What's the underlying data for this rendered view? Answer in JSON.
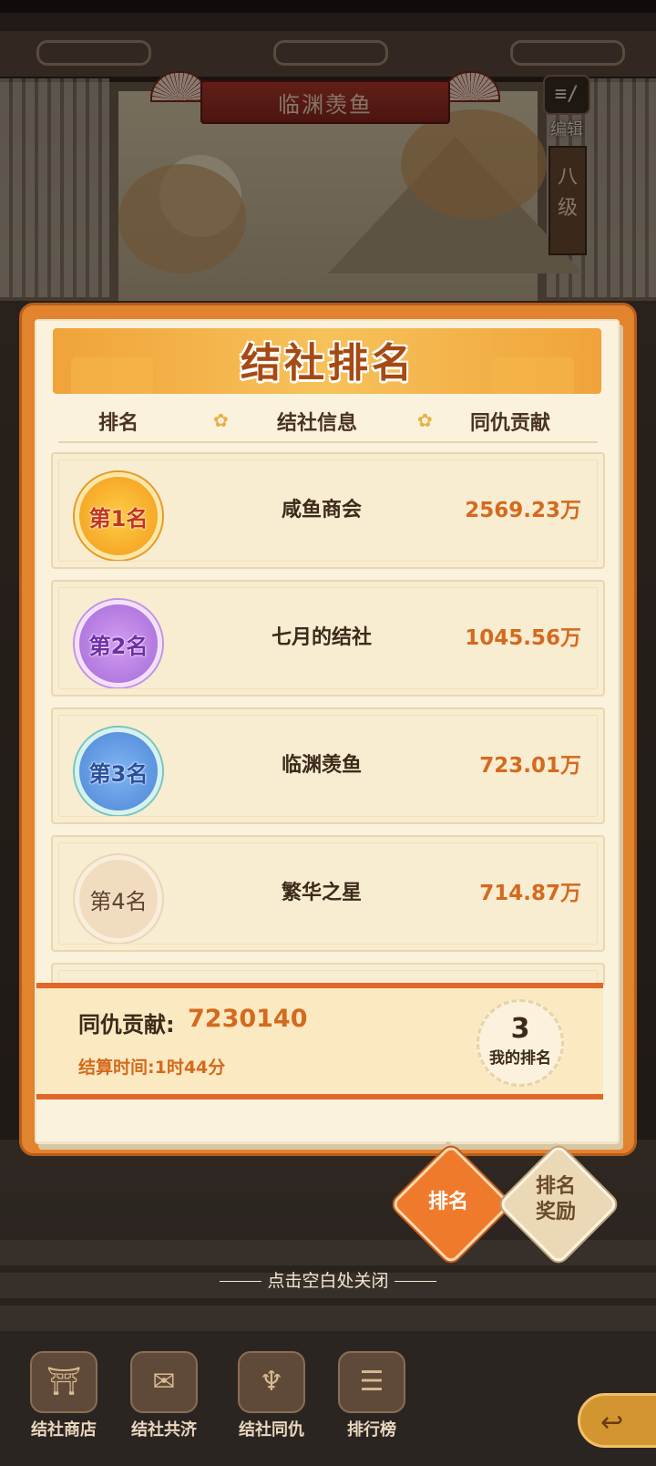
{
  "scene": {
    "banner_title": "临渊羡鱼",
    "edit_label": "编辑",
    "level_tag": "八级"
  },
  "panel": {
    "title": "结社排名",
    "columns": [
      "排名",
      "结社信息",
      "同仇贡献"
    ],
    "rows": [
      {
        "rank_label": "第1名",
        "guild": "咸鱼商会",
        "score": "2569.23万"
      },
      {
        "rank_label": "第2名",
        "guild": "七月的结社",
        "score": "1045.56万"
      },
      {
        "rank_label": "第3名",
        "guild": "临渊羡鱼",
        "score": "723.01万"
      },
      {
        "rank_label": "第4名",
        "guild": "繁华之星",
        "score": "714.87万"
      }
    ],
    "footer": {
      "contribution_label": "同仇贡献:",
      "contribution_value": "7230140",
      "settle_time": "结算时间:1时44分",
      "my_rank_value": "3",
      "my_rank_label": "我的排名"
    }
  },
  "tabs": {
    "rank": "排名",
    "reward_line1": "排名",
    "reward_line2": "奖励"
  },
  "close_hint": "点击空白处关闭",
  "nav": {
    "items": [
      {
        "label": "结社商店",
        "icon": "shop-icon"
      },
      {
        "label": "结社共济",
        "icon": "scroll-icon"
      },
      {
        "label": "结社同仇",
        "icon": "dragon-icon"
      },
      {
        "label": "排行榜",
        "icon": "leaderboard-icon"
      }
    ],
    "back_icon": "back-arrow-icon"
  },
  "colors": {
    "accent_orange": "#e2832e",
    "score_text": "#d46a1d",
    "paper": "#fbf2dd"
  }
}
